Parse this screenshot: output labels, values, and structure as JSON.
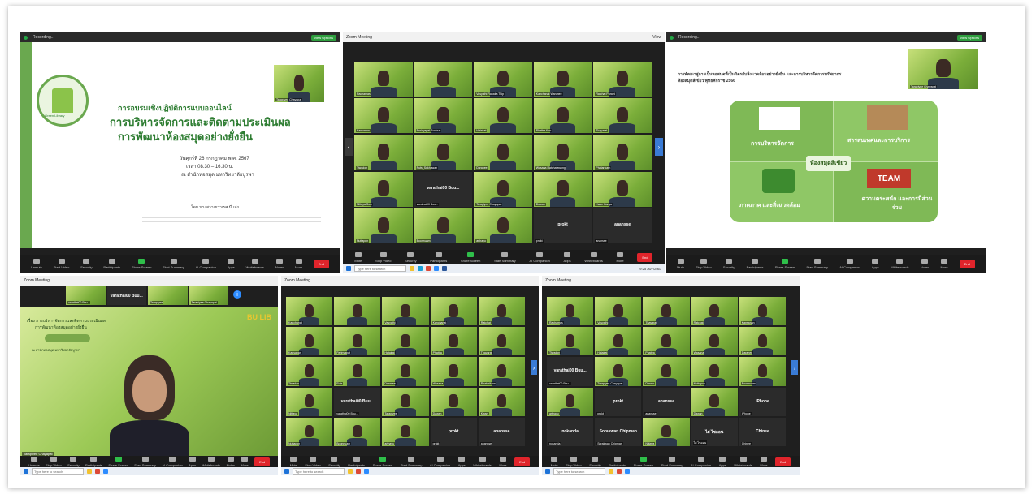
{
  "windows": {
    "top_left": {
      "recording_label": "Recording...",
      "view_label": "View Options",
      "speaker_name": "Tarapiyee Chayapat",
      "slide": {
        "line1": "การอบรมเชิงปฏิบัติการแบบออนไลน์",
        "line2": "การบริหารจัดการและติดตามประเมินผล",
        "line3": "การพัฒนาห้องสมุดอย่างยั่งยืน",
        "date": "วันศุกร์ที่ 26 กรกฎาคม พ.ศ. 2567",
        "time": "เวลา 08.30 – 16.30 น.",
        "place": "ณ สำนักหอสมุด มหาวิทยาลัยบูรพา",
        "by": "โดย นางสาวเยาวเรศ มีแสง",
        "logo_text": "Green Library"
      },
      "controls": [
        "Unmute",
        "Start Video",
        "Security",
        "Participants",
        "Share Screen",
        "Start Summary",
        "AI Companion",
        "Apps",
        "Whiteboards",
        "Notes",
        "More"
      ],
      "end_label": "End"
    },
    "top_middle": {
      "title": "Zoom Meeting",
      "view_label": "View",
      "tiles": [
        {
          "name": "Rachamas"
        },
        {
          "name": ""
        },
        {
          "name": "Vasyathi Ranaka Thip"
        },
        {
          "name": "Kanchanat Warunee"
        },
        {
          "name": "Ratchat Panchi"
        },
        {
          "name": "Kansanan"
        },
        {
          "name": "Parinyapat Boribun"
        },
        {
          "name": "Hatairat"
        },
        {
          "name": "Phattra Kon"
        },
        {
          "name": "Thayarat"
        },
        {
          "name": "Tiwadon"
        },
        {
          "name": "Ruts_Sukhawan"
        },
        {
          "name": "Daranee"
        },
        {
          "name": "Wasana Ratchatawong"
        },
        {
          "name": "Phatarikarn"
        },
        {
          "name": "Nittaya Sum"
        },
        {
          "name": "varathai00 Buu..."
        },
        {
          "name": "Tarapiyee Chayapat"
        },
        {
          "name": "Dawan"
        },
        {
          "name": "Kwan Kanya"
        },
        {
          "name": "Nuttapon"
        },
        {
          "name": "Boonnuam"
        },
        {
          "name": "arthayu"
        },
        {
          "name": "prokt"
        },
        {
          "name": "anansse"
        }
      ],
      "dark_tile_labels": [
        "varathai00 Buu...",
        "prokt",
        "anansse"
      ],
      "controls": [
        "Mute",
        "Stop Video",
        "Security",
        "Participants",
        "Share Screen",
        "Start Summary",
        "AI Companion",
        "Apps",
        "Whiteboards",
        "More"
      ],
      "end_label": "End",
      "search_placeholder": "Type here to search",
      "clock": "9:25 26/7/2567"
    },
    "top_right": {
      "recording_label": "Recording...",
      "view_label": "View Options",
      "speaker_name": "Tarapiyee Chayapat",
      "slide": {
        "header": "การพัฒนาสู่การเป็นหอสมุดที่เป็นมิตรกับสิ่งแวดล้อมอย่างยั่งยืน และการบริหารจัดการทรัพยากรห้องสมุดสีเขียว พุทธศักราช 2566",
        "center": "ห้องสมุดสีเขียว",
        "q1": "การบริหารจัดการ",
        "q2": "สารสนเทศและการบริการ",
        "q3": "ภาคภาค และสิ่งแวดล้อม",
        "q4": "ความตระหนัก และการมีส่วนร่วม",
        "team": "TEAM"
      },
      "controls": [
        "Mute",
        "Stop Video",
        "Security",
        "Participants",
        "Share Screen",
        "Start Summary",
        "AI Companion",
        "Apps",
        "Whiteboards",
        "Notes",
        "More"
      ],
      "end_label": "End"
    },
    "bottom_left": {
      "title": "Zoom Meeting",
      "speaker_name": "Tarapiyee Chayapat",
      "banner_line1": "เรื่อง การบริหารจัดการและติดตามประเมินผล",
      "banner_line2": "การพัฒนาห้องสมุดอย่างยั่งยืน",
      "banner_sub": "ณ สำนักหอสมุด มหาวิทยาลัยบูรพา",
      "corner_text": "BU LIB",
      "strip_labels": [
        "varathai00 Buu...",
        "Tarapiyee",
        "Tarapiyee Chayapat"
      ],
      "controls": [
        "Unmute",
        "Stop Video",
        "Security",
        "Participants",
        "Share Screen",
        "Start Summary",
        "AI Companion",
        "Apps",
        "Whiteboards",
        "Notes",
        "More"
      ],
      "end_label": "End",
      "search_placeholder": "Type here to search"
    },
    "bottom_middle": {
      "title": "Zoom Meeting",
      "tiles": [
        {
          "name": "Kanchanat"
        },
        {
          "name": ""
        },
        {
          "name": "Vasyathi"
        },
        {
          "name": "Kanchanat"
        },
        {
          "name": "Ratchat"
        },
        {
          "name": "Kansanan"
        },
        {
          "name": "Parinyapat"
        },
        {
          "name": "Hatairat"
        },
        {
          "name": "Phattra"
        },
        {
          "name": "Thayarat"
        },
        {
          "name": "Tiwadon"
        },
        {
          "name": "Ruts"
        },
        {
          "name": "Daranee"
        },
        {
          "name": "Wasana"
        },
        {
          "name": "Phatarikarn"
        },
        {
          "name": "Nittaya"
        },
        {
          "name": "varathai00 Buu..."
        },
        {
          "name": "Tarapiyee"
        },
        {
          "name": "Dawan"
        },
        {
          "name": "Kwan"
        },
        {
          "name": "Nuttapon"
        },
        {
          "name": "Boonnuam"
        },
        {
          "name": "arthayu"
        },
        {
          "name": "prokt"
        },
        {
          "name": "anansse"
        }
      ],
      "dark_tile_labels": [
        "varathai00 Buu...",
        "prokt",
        "anansse"
      ],
      "controls": [
        "Mute",
        "Stop Video",
        "Security",
        "Participants",
        "Share Screen",
        "Start Summary",
        "AI Companion",
        "Apps",
        "Whiteboards",
        "More"
      ],
      "end_label": "End",
      "search_placeholder": "Type here to search"
    },
    "bottom_right": {
      "title": "Zoom Meeting",
      "tiles": [
        {
          "name": "Rachamas"
        },
        {
          "name": "Vasyathi"
        },
        {
          "name": "Thayarat"
        },
        {
          "name": "Ratchat"
        },
        {
          "name": "Kansanan"
        },
        {
          "name": "Tiwadon"
        },
        {
          "name": "Hatairat"
        },
        {
          "name": "Phattra"
        },
        {
          "name": "Wasana"
        },
        {
          "name": "Daranee"
        },
        {
          "name": "varathai00 Buu..."
        },
        {
          "name": "Tarapiyee Chayapat"
        },
        {
          "name": "Dawan"
        },
        {
          "name": "Nuttapon"
        },
        {
          "name": "Boonnuam"
        },
        {
          "name": "arthayu"
        },
        {
          "name": "prokt"
        },
        {
          "name": "anansse"
        },
        {
          "name": "Dawan"
        },
        {
          "name": "iPhone"
        },
        {
          "name": "nokanda"
        },
        {
          "name": "Sorakwan Chipman"
        },
        {
          "name": "Nittaya"
        },
        {
          "name": "ไผ่ ไซออน"
        },
        {
          "name": "Chinee"
        }
      ],
      "dark_tile_labels": [
        "varathai00 Buu...",
        "prokt",
        "anansse",
        "iPhone",
        "nokanda",
        "Sorakwan Chipman",
        "ไผ่ ไซออน",
        "Chinee"
      ],
      "controls": [
        "Mute",
        "Stop Video",
        "Security",
        "Participants",
        "Share Screen",
        "Start Summary",
        "AI Companion",
        "Apps",
        "Whiteboards",
        "More"
      ],
      "end_label": "End",
      "search_placeholder": "Type here to search"
    }
  },
  "colors": {
    "zoom_dark": "#1f1f1f",
    "end_red": "#e0242b",
    "share_green": "#2fbf4a",
    "slide_green": "#6aa84f"
  }
}
